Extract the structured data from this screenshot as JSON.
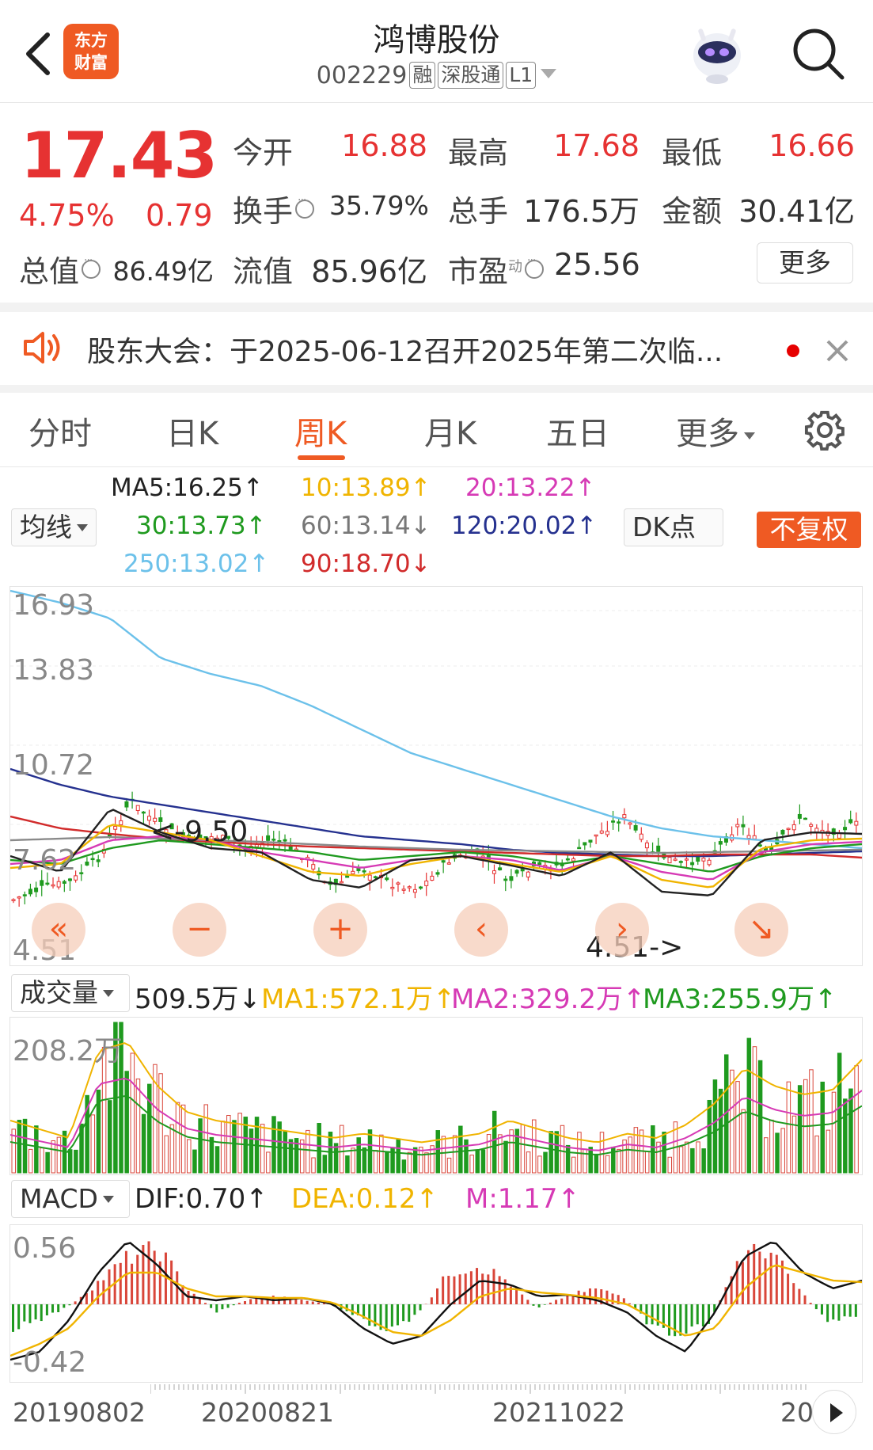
{
  "header": {
    "stock_name": "鸿博股份",
    "stock_code": "002229",
    "tags": [
      "融",
      "深股通",
      "L1"
    ],
    "logo_text_1": "东方",
    "logo_text_2": "财富",
    "icons": [
      "back-arrow-icon",
      "robot-assistant-icon",
      "search-icon"
    ]
  },
  "quote": {
    "price": "17.43",
    "change_pct": "4.75%",
    "change": "0.79",
    "open_label": "今开",
    "open": "16.88",
    "high_label": "最高",
    "high": "17.68",
    "low_label": "最低",
    "low": "16.66",
    "turnover_label": "换手",
    "turnover": "35.79%",
    "volume_label": "总手",
    "volume": "176.5万",
    "amount_label": "金额",
    "amount": "30.41亿",
    "mktcap_label": "总值",
    "mktcap": "86.49亿",
    "float_label": "流值",
    "float_cap": "85.96亿",
    "pe_label": "市盈",
    "pe_sup": "动",
    "pe": "25.56",
    "more_label": "更多",
    "up_color": "#e63232"
  },
  "notice": {
    "text": "股东大会：于2025-06-12召开2025年第二次临...",
    "icons": [
      "speaker-icon",
      "close-icon"
    ]
  },
  "tabs": [
    {
      "label": "分时",
      "active": false
    },
    {
      "label": "日K",
      "active": false
    },
    {
      "label": "周K",
      "active": true
    },
    {
      "label": "月K",
      "active": false
    },
    {
      "label": "五日",
      "active": false
    },
    {
      "label": "更多",
      "active": false
    }
  ],
  "ma": {
    "selector": "均线",
    "ma5": "MA5:16.25↑",
    "ma10": "10:13.89↑",
    "ma20": "20:13.22↑",
    "ma30": "30:13.73↑",
    "ma60": "60:13.14↓",
    "ma120": "120:20.02↑",
    "ma250": "250:13.02↑",
    "ma90": "90:18.70↓",
    "dk_label": "DK点",
    "adjust_label": "不复权"
  },
  "price_chart": {
    "y_labels": [
      "16.93",
      "13.83",
      "10.72",
      "7.62",
      "4.51"
    ],
    "max_annot": "<-9.50",
    "min_annot": "4.51->",
    "controls": [
      "«",
      "−",
      "+",
      "‹",
      "›",
      "↘"
    ]
  },
  "volume": {
    "selector": "成交量",
    "value": "509.5万↓",
    "ma1": "MA1:572.1万↑",
    "ma2": "MA2:329.2万↑",
    "ma3": "MA3:255.9万↑",
    "y_label": "208.2万"
  },
  "macd": {
    "selector": "MACD",
    "dif": "DIF:0.70↑",
    "dea": "DEA:0.12↑",
    "m": "M:1.17↑",
    "y_top": "0.56",
    "y_bottom": "-0.42"
  },
  "x_axis": [
    "20190802",
    "20200821",
    "20211022",
    "20"
  ],
  "colors": {
    "accent": "#ef5a23",
    "ma5": "#222222",
    "ma10": "#f0b400",
    "ma20": "#d63ab5",
    "ma30": "#1f9a1f",
    "ma60": "#8a8a8a",
    "ma120": "#25318f",
    "ma250": "#6cc1ea",
    "ma90": "#d12b2b"
  }
}
